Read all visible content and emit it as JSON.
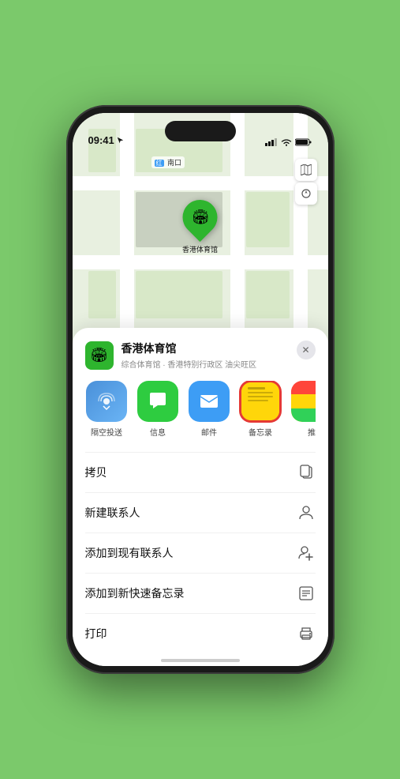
{
  "statusBar": {
    "time": "09:41",
    "locationArrow": "▶"
  },
  "map": {
    "label": "南口",
    "controls": [
      "map-icon",
      "location-icon"
    ]
  },
  "venue": {
    "name": "香港体育馆",
    "subtitle": "综合体育馆 · 香港特别行政区 油尖旺区"
  },
  "shareApps": [
    {
      "id": "airdrop",
      "label": "隔空投送",
      "icon": "📡"
    },
    {
      "id": "messages",
      "label": "信息",
      "icon": "💬"
    },
    {
      "id": "mail",
      "label": "邮件",
      "icon": "✉️"
    },
    {
      "id": "notes",
      "label": "备忘录",
      "icon": ""
    },
    {
      "id": "more",
      "label": "推",
      "icon": ""
    }
  ],
  "actions": [
    {
      "id": "copy",
      "label": "拷贝",
      "icon": "copy"
    },
    {
      "id": "new-contact",
      "label": "新建联系人",
      "icon": "person"
    },
    {
      "id": "add-existing",
      "label": "添加到现有联系人",
      "icon": "person-add"
    },
    {
      "id": "quick-note",
      "label": "添加到新快速备忘录",
      "icon": "note"
    },
    {
      "id": "print",
      "label": "打印",
      "icon": "print"
    }
  ],
  "closeButton": "✕"
}
